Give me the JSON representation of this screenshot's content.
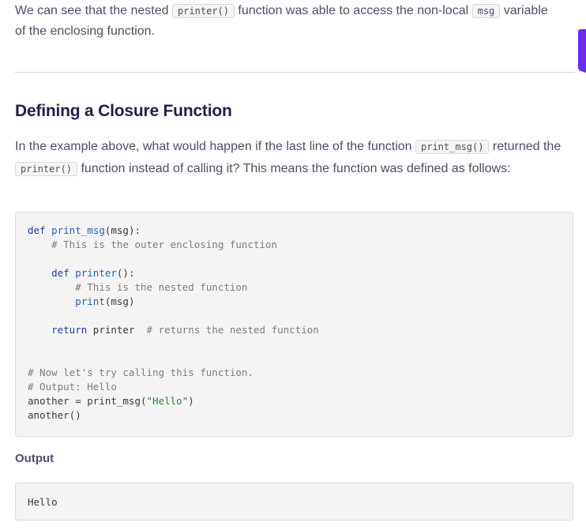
{
  "intro": {
    "part1": "We can see that the nested ",
    "code1": "printer()",
    "part2": " function was able to access the non-local ",
    "code2": "msg",
    "part3": " variable of the enclosing function."
  },
  "section": {
    "heading": "Defining a Closure Function",
    "para": {
      "part1": "In the example above, what would happen if the last line of the function ",
      "code1": "print_msg()",
      "part2": " returned the ",
      "code2": "printer()",
      "part3": " function instead of calling it? This means the function was defined as follows:"
    }
  },
  "code": {
    "l1_kw": "def",
    "l1_fn": "print_msg",
    "l1_rest": "(msg):",
    "l2_cm": "# This is the outer enclosing function",
    "l3_kw": "def",
    "l3_fn": "printer",
    "l3_rest": "():",
    "l4_cm": "# This is the nested function",
    "l5_bi": "print",
    "l5_rest": "(msg)",
    "l6_kw": "return",
    "l6_rest": " printer  ",
    "l6_cm": "# returns the nested function",
    "l7_cm": "# Now let's try calling this function.",
    "l8_cm": "# Output: Hello",
    "l9_a": "another = print_msg(",
    "l9_st": "\"Hello\"",
    "l9_b": ")",
    "l10": "another()"
  },
  "output": {
    "label": "Output",
    "text": "Hello"
  },
  "colors": {
    "accent": "#6a2ee8",
    "heading": "#1f2147",
    "body_text": "#4b5066"
  }
}
